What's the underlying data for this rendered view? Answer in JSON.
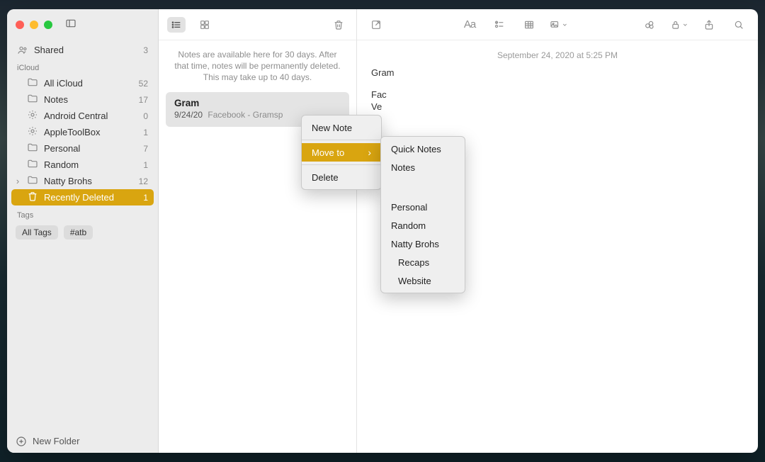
{
  "sidebar": {
    "shared": {
      "label": "Shared",
      "count": "3"
    },
    "section_icloud": "iCloud",
    "folders": [
      {
        "name": "All iCloud",
        "count": "52",
        "type": "folder"
      },
      {
        "name": "Notes",
        "count": "17",
        "type": "folder"
      },
      {
        "name": "Android Central",
        "count": "0",
        "type": "smart"
      },
      {
        "name": "AppleToolBox",
        "count": "1",
        "type": "smart"
      },
      {
        "name": "Personal",
        "count": "7",
        "type": "folder"
      },
      {
        "name": "Random",
        "count": "1",
        "type": "folder"
      },
      {
        "name": "Natty Brohs",
        "count": "12",
        "type": "folder",
        "expandable": true
      },
      {
        "name": "Recently Deleted",
        "count": "1",
        "type": "trash",
        "selected": true
      }
    ],
    "section_tags": "Tags",
    "tags": [
      "All Tags",
      "#atb"
    ],
    "new_folder": "New Folder"
  },
  "list": {
    "notice": "Notes are available here for 30 days. After that time, notes will be permanently deleted. This may take up to 40 days.",
    "note": {
      "title": "Gram",
      "date": "9/24/20",
      "preview": "Facebook - Gramsp"
    }
  },
  "detail": {
    "date": "September 24, 2020 at 5:25 PM",
    "title": "Gram",
    "lines": [
      "Fac",
      "Ve"
    ]
  },
  "context_menu": {
    "new_note": "New Note",
    "move_to": "Move to",
    "delete": "Delete",
    "submenu": [
      {
        "label": "Quick Notes",
        "indent": false
      },
      {
        "label": "Notes",
        "indent": false
      },
      {
        "label": "Personal",
        "indent": false,
        "gap_before": true
      },
      {
        "label": "Random",
        "indent": false
      },
      {
        "label": "Natty Brohs",
        "indent": false
      },
      {
        "label": "Recaps",
        "indent": true
      },
      {
        "label": "Website",
        "indent": true
      }
    ]
  }
}
